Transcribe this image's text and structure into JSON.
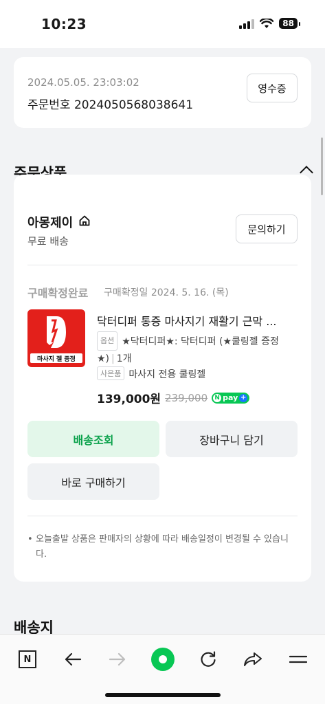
{
  "status_bar": {
    "time": "10:23",
    "battery": "88"
  },
  "order": {
    "datetime": "2024.05.05. 23:03:02",
    "number": "주문번호 2024050568038641",
    "receipt_label": "영수증"
  },
  "sections": {
    "ordered_items": "주문상품",
    "shipping_address": "배송지"
  },
  "seller": {
    "name": "아몽제이",
    "shipping": "무료 배송",
    "inquiry_label": "문의하기"
  },
  "product": {
    "status": "구매확정완료",
    "confirm_date": "구매확정일 2024. 5. 16. (목)",
    "thumb_badge": "마사지 젤 증정",
    "name": "닥터디퍼 통증 마사지기 재활기 근막 ...",
    "option_tag": "옵션",
    "option_text": "★닥터디퍼★: 닥터디퍼 (★쿨링젤 증정★)",
    "quantity": "1개",
    "gift_tag": "사은품",
    "gift_text": "마사지 전용 쿨링젤",
    "price": "139,000원",
    "original_price": "239,000",
    "npay_label": "pay"
  },
  "actions": {
    "track": "배송조회",
    "cart": "장바구니 담기",
    "buy_now": "바로 구매하기"
  },
  "notice": "오늘출발 상품은 판매자의 상황에 따라 배송일정이 변경될 수 있습니다.",
  "bottom_nav": {
    "n_label": "N"
  }
}
